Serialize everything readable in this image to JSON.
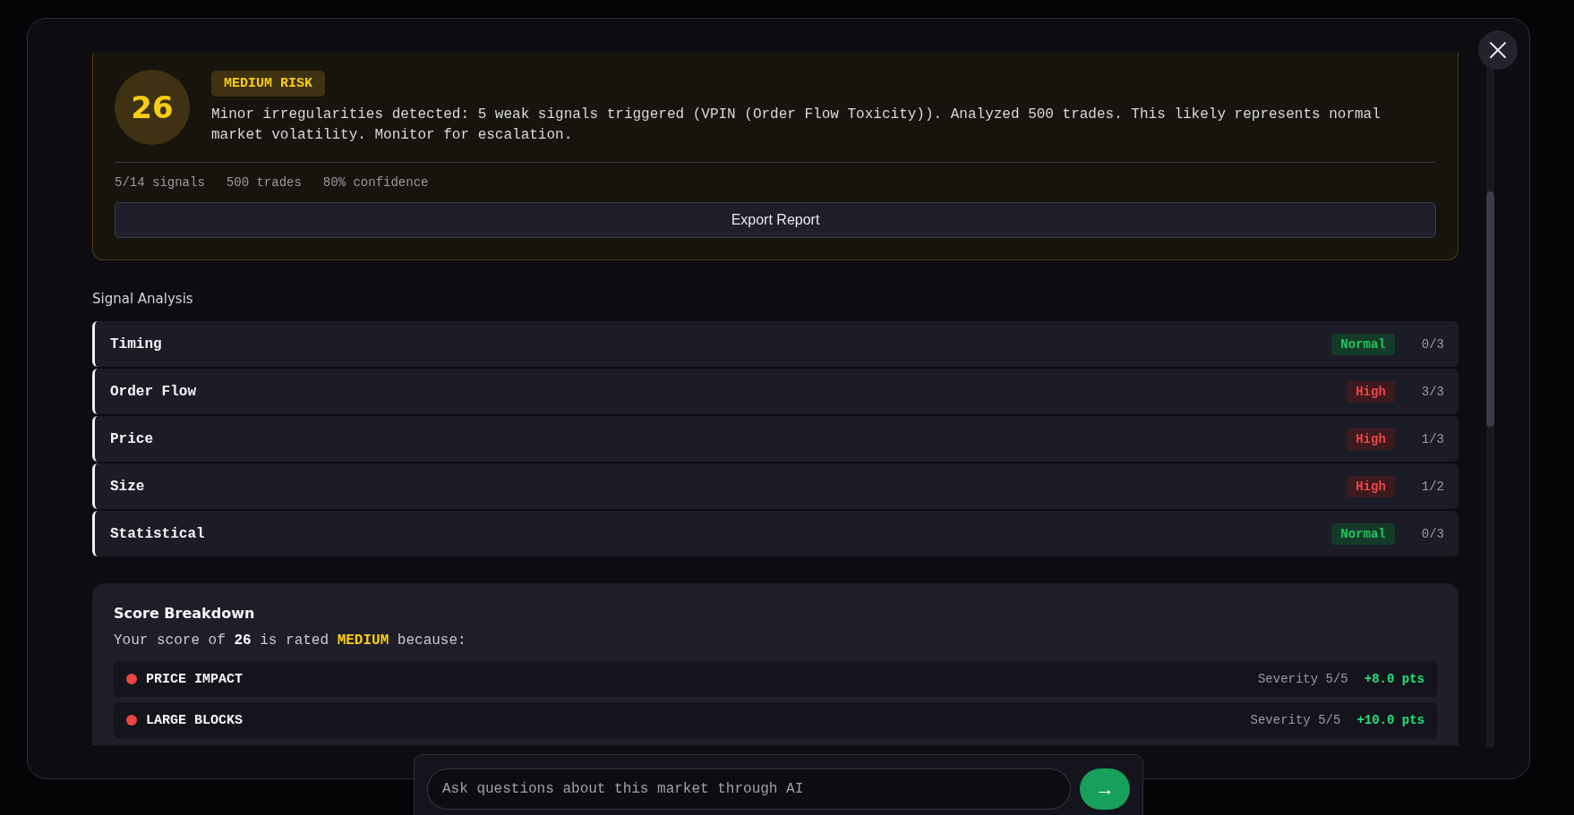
{
  "risk": {
    "score": "26",
    "kind": "medium",
    "badge": "MEDIUM RISK",
    "summary": "Minor irregularities detected: 5 weak signals triggered (VPIN (Order Flow Toxicity)). Analyzed 500 trades. This likely represents normal market volatility. Monitor for escalation.",
    "stats": [
      "5/14 signals",
      "500 trades",
      "80% confidence"
    ],
    "export_button": "Export Report"
  },
  "signal_analysis": {
    "title": "Signal Analysis",
    "rows": [
      {
        "name": "Timing",
        "status": "Normal",
        "kind": "normal",
        "count": "0/3"
      },
      {
        "name": "Order Flow",
        "status": "High",
        "kind": "high",
        "count": "3/3"
      },
      {
        "name": "Price",
        "status": "High",
        "kind": "high",
        "count": "1/3"
      },
      {
        "name": "Size",
        "status": "High",
        "kind": "high",
        "count": "1/2"
      },
      {
        "name": "Statistical",
        "status": "Normal",
        "kind": "normal",
        "count": "0/3"
      }
    ]
  },
  "score_breakdown": {
    "title": "Score Breakdown",
    "sentence": "Your score of **26** is rated **MEDIUM** because:",
    "items": [
      {
        "name": "PRICE IMPACT",
        "color": "#ef4444",
        "severity": "Severity 5/5",
        "points": "+8.0 pts"
      },
      {
        "name": "LARGE BLOCKS",
        "color": "#ef4444",
        "severity": "Severity 5/5",
        "points": "+10.0 pts"
      }
    ]
  },
  "chat": {
    "placeholder": "Ask questions about this market through AI",
    "send": "→"
  }
}
